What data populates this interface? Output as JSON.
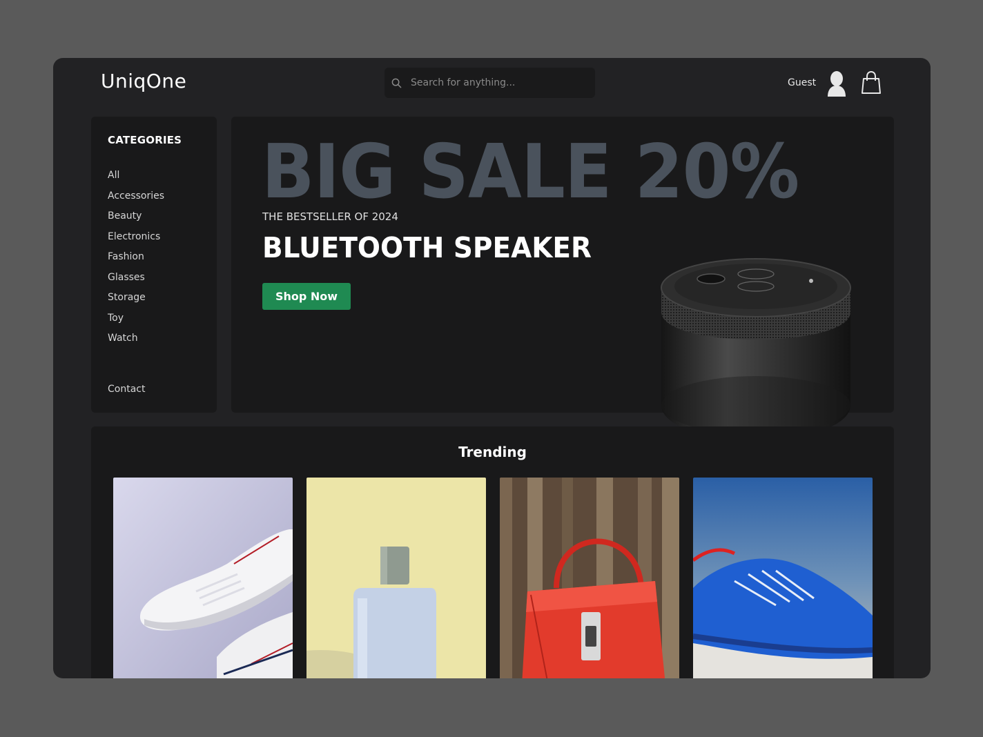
{
  "header": {
    "logo": "UniqOne",
    "search_placeholder": "Search for anything...",
    "user_label": "Guest",
    "icons": [
      "search-icon",
      "user-icon",
      "shopping-bag-icon"
    ]
  },
  "sidebar": {
    "title": "CATEGORIES",
    "items": [
      {
        "label": "All"
      },
      {
        "label": "Accessories"
      },
      {
        "label": "Beauty"
      },
      {
        "label": "Electronics"
      },
      {
        "label": "Fashion"
      },
      {
        "label": "Glasses"
      },
      {
        "label": "Storage"
      },
      {
        "label": "Toy"
      },
      {
        "label": "Watch"
      }
    ],
    "contact": "Contact"
  },
  "hero": {
    "headline": "BIG SALE 20%",
    "subtitle": "THE BESTSELLER OF 2024",
    "product": "BLUETOOTH SPEAKER",
    "cta": "Shop Now"
  },
  "trending": {
    "title": "Trending",
    "products": [
      {
        "image": "white-sneakers"
      },
      {
        "image": "perfume-bottle"
      },
      {
        "image": "red-handbag"
      },
      {
        "image": "blue-sneakers"
      }
    ]
  },
  "colors": {
    "page_bg": "#5a5a5a",
    "window_bg": "#222224",
    "panel_bg": "#19191a",
    "headline": "#4a525c",
    "cta": "#1f8a52"
  }
}
